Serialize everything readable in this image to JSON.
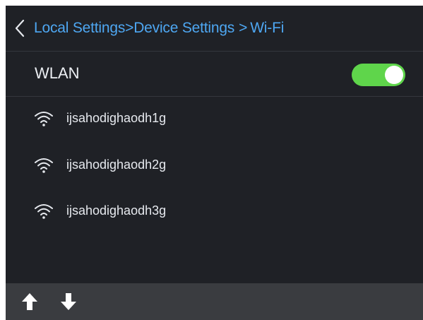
{
  "header": {
    "breadcrumb": [
      {
        "label": "Local Settings"
      },
      {
        "label": "Device Settings"
      },
      {
        "label": "Wi-Fi"
      }
    ],
    "separator": ">",
    "back_icon": "chevron-left-icon"
  },
  "wlan": {
    "label": "WLAN",
    "enabled": true
  },
  "networks": [
    {
      "name": "ijsahodighaodh1g",
      "icon": "wifi-icon"
    },
    {
      "name": "ijsahodighaodh2g",
      "icon": "wifi-icon"
    },
    {
      "name": "ijsahodighaodh3g",
      "icon": "wifi-icon"
    }
  ],
  "footer": {
    "up_icon": "arrow-up-icon",
    "down_icon": "arrow-down-icon"
  },
  "colors": {
    "background": "#1f2126",
    "accent": "#4ea7f2",
    "toggle_on": "#5fd54b",
    "footer": "#3a3c40"
  }
}
